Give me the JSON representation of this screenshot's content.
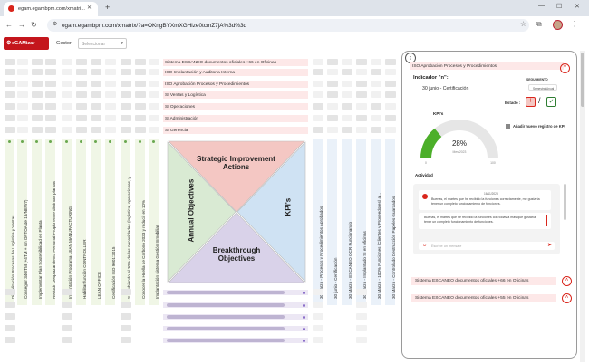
{
  "browser": {
    "tab_title": "egam.egambpm.com/xmatri...",
    "new_tab": "+",
    "url": "egam.egambpm.com/xmatrix/?a=OKngBYXmXGHize0tcmZ7jA%3d%3d"
  },
  "toolbar": {
    "brand_button": "eGAMizar",
    "gestor_label": "Gestor",
    "gestor_placeholder": "Seleccionar"
  },
  "top_rows": [
    "Sistema ESCANEO documentos oficiales +66 en Oficinas",
    "ISO Implantación y Auditoría Interna",
    "ISO Aprobación Procesos y Procedimientos",
    "SI Ventas y Logística",
    "SI Operaciones",
    "SI Administración",
    "SI Gerencia"
  ],
  "left_columns": [
    "Digitalización Procesos de Logística y Ventas",
    "Conseguir 340/TM (+4TM + sin OPTOA de 18/NEW7)",
    "Implementar Plan Sostenibilidad en Planta",
    "Reducir Desplazamiento Personal Propio entre distintas plantas",
    "Implantación Programa LEAN MANUFACTURING",
    "Habilitar función CONTROLLER",
    "LEAN OFFICE",
    "Certificación ISO 9001:2015",
    "S.I. cubiendo al 30% de las necesidades (logística, operaciones, y...",
    "Conocer la Huella de Carbono 2023 y reducir en 10%",
    "Implantación sistema Gestión Inmobiliar"
  ],
  "right_columns": [
    "30 marzo - Procesos y Procedimientos Aprobados",
    "30 junio - Certificación",
    "30 Marzo - ESCANEO OCR Funcionando",
    "30 Marzo - Implantado SI en oficinas",
    "30 Marzo - 100% Funciones (Clientes y Proveedores) a...",
    "30 Marzo - Controlado Destrucción Papeles Guardados"
  ],
  "diamond": {
    "top": "Strategic Improvement Actions",
    "left": "Annual Objectives",
    "right": "KPI's",
    "bottom": "Breakthrough Objectives"
  },
  "panel": {
    "header": "ISO Aprobación Procesos y Procedimientos",
    "indicator_title": "Indicador \"n\":",
    "indicator_date": "30 junio - Certificación",
    "seguimiento_label": "SEGUIMIENTO",
    "seguimiento_button": "Semestral Anual",
    "estado_label": "Estado :",
    "kpis_label": "KPI's",
    "add_record": "Añadir nuevo registro de KPI",
    "gauge": {
      "value_text": "28%",
      "sub_text": "Mes 2023",
      "fraction": 0.28,
      "min_label": "0",
      "max_label": "100"
    },
    "activity_label": "Actividad",
    "msg1_date": "16/11/2023",
    "msg1": "Buenas, el martes que he recibido la funciones correctamente, me gustaría tener un completo funcionamiento de funciones.",
    "msg2": "Buenas, el martes que he recibido la funciones con todavía más que gustaría tener un completo funcionamiento de funciones.",
    "input_placeholder": "Escribe un mensaje",
    "bottom_rows": [
      "Sistema ESCANEO documentos oficiales +66 en Oficinas",
      "Sistema ESCANEO documentos oficiales +55 en Oficinas"
    ]
  },
  "colors": {
    "brand": "#c4161c",
    "top": "#f4c7c3",
    "left": "#d9ead3",
    "right": "#cfe2f3",
    "bottom": "#d9d2e9",
    "gauge": "#4caf2a"
  }
}
